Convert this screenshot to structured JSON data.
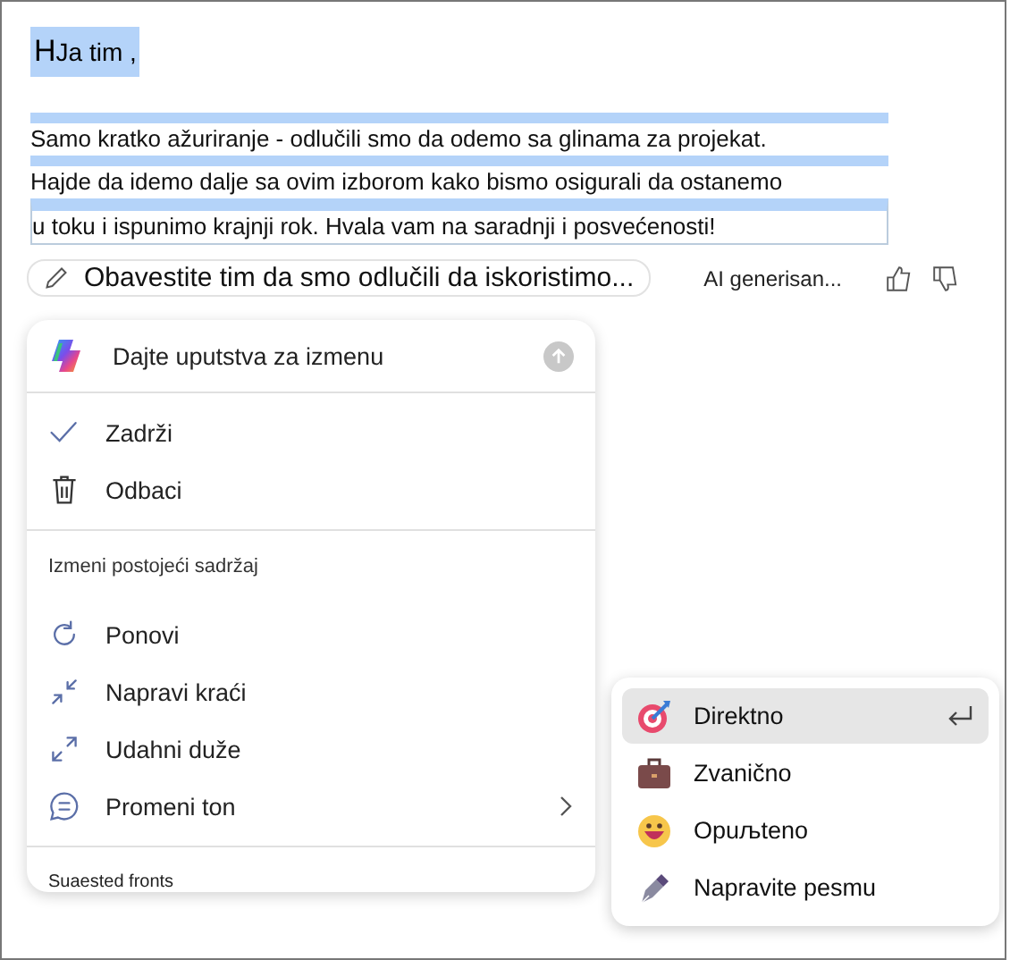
{
  "document": {
    "greeting": "HJa tim ,",
    "lines": [
      "Samo kratko ažuriranje - odlučili smo da odemo sa glinama za projekat.",
      "Hajde da idemo dalje sa ovim izborom kako bismo osigurali da ostanemo",
      "u toku i ispunimo krajnji rok. Hvala vam na saradnji i posvećenosti!"
    ]
  },
  "prompt_chip": "Obavestite tim da smo odlučili da iskoristimo...",
  "ai_label": "AI generisan...",
  "menu": {
    "input": {
      "placeholder": "Dajte uputstva za izmenu"
    },
    "send_disabled": true,
    "actions": [
      {
        "label": "Zadrži"
      },
      {
        "label": "Odbaci"
      }
    ],
    "section_title": "Izmeni postojeći sadržaj",
    "edits": [
      {
        "label": "Ponovi",
        "submenu": false
      },
      {
        "label": "Napravi kraći",
        "submenu": false
      },
      {
        "label": "Udahni duže",
        "submenu": false
      },
      {
        "label": "Promeni ton",
        "submenu": true
      }
    ],
    "footer_heading": "Suaested fronts"
  },
  "submenu": {
    "items": [
      {
        "label": "Direktno",
        "selected": true
      },
      {
        "label": "Zvanično",
        "selected": false
      },
      {
        "label": "Opuљteno",
        "selected": false
      },
      {
        "label": "Napravite pesmu",
        "selected": false
      }
    ]
  }
}
